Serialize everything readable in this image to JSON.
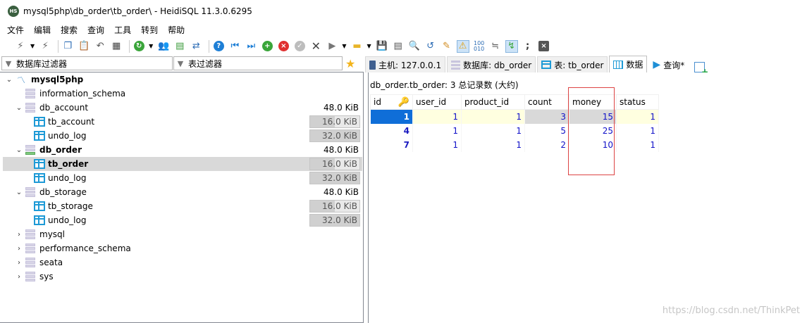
{
  "window": {
    "title": "mysql5php\\db_order\\tb_order\\ - HeidiSQL 11.3.0.6295",
    "app_icon_text": "HS"
  },
  "menu": [
    "文件",
    "编辑",
    "搜索",
    "查询",
    "工具",
    "转到",
    "帮助"
  ],
  "filters": {
    "db_filter": "数据库过滤器",
    "table_filter": "表过滤器"
  },
  "tree": {
    "root": "mysql5php",
    "items": {
      "information_schema": "information_schema",
      "db_account": {
        "label": "db_account",
        "size": "48.0 KiB"
      },
      "tb_account": {
        "label": "tb_account",
        "size": "16.0 KiB",
        "fill": 0.5
      },
      "undo_log_1": {
        "label": "undo_log",
        "size": "32.0 KiB",
        "fill": 1.0
      },
      "db_order": {
        "label": "db_order",
        "size": "48.0 KiB"
      },
      "tb_order": {
        "label": "tb_order",
        "size": "16.0 KiB",
        "fill": 0.5
      },
      "undo_log_2": {
        "label": "undo_log",
        "size": "32.0 KiB",
        "fill": 1.0
      },
      "db_storage": {
        "label": "db_storage",
        "size": "48.0 KiB"
      },
      "tb_storage": {
        "label": "tb_storage",
        "size": "16.0 KiB",
        "fill": 0.5
      },
      "undo_log_3": {
        "label": "undo_log",
        "size": "32.0 KiB",
        "fill": 1.0
      },
      "mysql": "mysql",
      "performance_schema": "performance_schema",
      "seata": "seata",
      "sys": "sys"
    }
  },
  "tabs": {
    "host": "主机: 127.0.0.1",
    "database": "数据库: db_order",
    "table": "表: tb_order",
    "data": "数据",
    "query": "查询*"
  },
  "data": {
    "header": "db_order.tb_order: 3 总记录数 (大约)",
    "columns": [
      "id",
      "user_id",
      "product_id",
      "count",
      "money",
      "status"
    ],
    "rows": [
      [
        "1",
        "1",
        "1",
        "3",
        "15",
        "1"
      ],
      [
        "4",
        "1",
        "1",
        "5",
        "25",
        "1"
      ],
      [
        "7",
        "1",
        "1",
        "2",
        "10",
        "1"
      ]
    ]
  },
  "watermark": "https://blog.csdn.net/ThinkPet",
  "colors": {
    "selection": "#0f6ed8",
    "accent": "#1e9ad6",
    "highlight_box": "#dd4444"
  }
}
